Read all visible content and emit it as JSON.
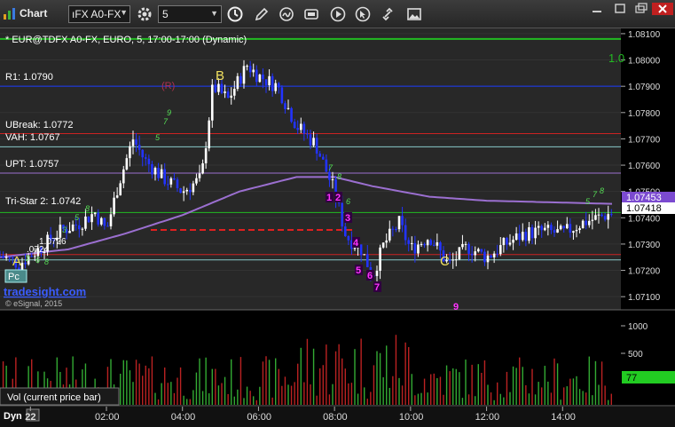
{
  "window": {
    "title": "Chart"
  },
  "toolbar": {
    "symbol": "ıFX A0-FX",
    "interval": "5",
    "icons": [
      "gear-icon",
      "refresh-clock-icon",
      "pencil-icon",
      "redraw-icon",
      "settings-panel-icon",
      "play-icon",
      "cursor-icon",
      "link-icon",
      "picture-icon"
    ]
  },
  "header": {
    "title": "* EUR@TDFX A0-FX, EURO, 5, 17:00-17:00 (Dynamic)"
  },
  "colors": {
    "green_line": "#22bb22",
    "blue_line": "#1a3cff",
    "red_line": "#cc2222",
    "cyan_line": "#88c8c8",
    "purple_line": "#9b6fd0",
    "candle_up": "#ffffff",
    "candle_down": "#2233ff",
    "price_tag": "#7b4ad0",
    "vol_tag": "#22cc22"
  },
  "levels": [
    {
      "label": "",
      "price": 1.0808,
      "color": "green",
      "right_text": "1.0"
    },
    {
      "label": "R1: 1.0790",
      "price": 1.079,
      "color": "blue"
    },
    {
      "label": "UBreak: 1.0772",
      "price": 1.0772,
      "color": "red"
    },
    {
      "label": "VAH: 1.0767",
      "price": 1.0767,
      "color": "cyan"
    },
    {
      "label": "UPT: 1.0757",
      "price": 1.0757,
      "color": "purple"
    },
    {
      "label": "Tri-Star 2: 1.0742",
      "price": 1.0742,
      "color": "green"
    },
    {
      "label": "1.0726",
      "price": 1.0726,
      "color": "red"
    },
    {
      "label": ".0724",
      "price": 1.0724,
      "color": "cyan"
    }
  ],
  "annotations": {
    "wave_labels": [
      "A",
      "B",
      "C"
    ],
    "r_marker": "(R)",
    "seq_numbers": [
      "1",
      "2",
      "3",
      "4",
      "5",
      "6",
      "7",
      "9"
    ],
    "watermark": "tradesight.com",
    "pc_badge": "Pc",
    "copyright": "© eSignal, 2015",
    "dyn": "Dyn"
  },
  "volume_panel": {
    "label": "Vol (current price bar)",
    "current": "77"
  },
  "chart_data": {
    "type": "candlestick",
    "title": "* EUR@TDFX A0-FX, EURO, 5, 17:00-17:00 (Dynamic)",
    "y_ticks": [
      "1.08100",
      "1.08000",
      "1.07900",
      "1.07800",
      "1.07700",
      "1.07600",
      "1.07500",
      "1.07400",
      "1.07300",
      "1.07200",
      "1.07100"
    ],
    "ylim": [
      1.0705,
      1.0812
    ],
    "last_price": "1.07418",
    "tag_prices": [
      "1.07453",
      "1.07418"
    ],
    "x_ticks": [
      "22",
      "02:00",
      "04:00",
      "06:00",
      "08:00",
      "10:00",
      "12:00",
      "14:00"
    ],
    "vol_ticks": [
      "1000",
      "500"
    ],
    "x_start_hour": -0.8,
    "x_end_hour": 15.3,
    "approx_path": [
      {
        "t": -0.8,
        "p": 1.07255
      },
      {
        "t": -0.3,
        "p": 1.07225
      },
      {
        "t": 0.3,
        "p": 1.0729
      },
      {
        "t": 0.8,
        "p": 1.0735
      },
      {
        "t": 1.3,
        "p": 1.0738
      },
      {
        "t": 1.7,
        "p": 1.0742
      },
      {
        "t": 2.0,
        "p": 1.0735
      },
      {
        "t": 2.3,
        "p": 1.0752
      },
      {
        "t": 2.7,
        "p": 1.077
      },
      {
        "t": 3.0,
        "p": 1.0762
      },
      {
        "t": 3.5,
        "p": 1.0755
      },
      {
        "t": 4.0,
        "p": 1.075
      },
      {
        "t": 4.5,
        "p": 1.0755
      },
      {
        "t": 4.8,
        "p": 1.079
      },
      {
        "t": 5.2,
        "p": 1.0785
      },
      {
        "t": 5.7,
        "p": 1.0798
      },
      {
        "t": 6.0,
        "p": 1.0794
      },
      {
        "t": 6.5,
        "p": 1.079
      },
      {
        "t": 7.0,
        "p": 1.0775
      },
      {
        "t": 7.5,
        "p": 1.0768
      },
      {
        "t": 8.0,
        "p": 1.075
      },
      {
        "t": 8.3,
        "p": 1.0733
      },
      {
        "t": 8.7,
        "p": 1.0728
      },
      {
        "t": 9.0,
        "p": 1.0718
      },
      {
        "t": 9.3,
        "p": 1.073
      },
      {
        "t": 9.7,
        "p": 1.0738
      },
      {
        "t": 10.0,
        "p": 1.0728
      },
      {
        "t": 10.5,
        "p": 1.0733
      },
      {
        "t": 11.0,
        "p": 1.0722
      },
      {
        "t": 11.5,
        "p": 1.0729
      },
      {
        "t": 12.0,
        "p": 1.0725
      },
      {
        "t": 12.5,
        "p": 1.073
      },
      {
        "t": 13.0,
        "p": 1.0734
      },
      {
        "t": 13.5,
        "p": 1.0735
      },
      {
        "t": 14.0,
        "p": 1.0734
      },
      {
        "t": 14.5,
        "p": 1.0738
      },
      {
        "t": 15.3,
        "p": 1.07418
      }
    ],
    "ma_path": [
      {
        "t": -0.8,
        "p": 1.0725
      },
      {
        "t": 1.0,
        "p": 1.0728
      },
      {
        "t": 2.5,
        "p": 1.0734
      },
      {
        "t": 4.0,
        "p": 1.0741
      },
      {
        "t": 5.5,
        "p": 1.075
      },
      {
        "t": 7.0,
        "p": 1.07555
      },
      {
        "t": 8.0,
        "p": 1.07555
      },
      {
        "t": 9.0,
        "p": 1.0752
      },
      {
        "t": 10.5,
        "p": 1.0748
      },
      {
        "t": 12.0,
        "p": 1.07465
      },
      {
        "t": 15.3,
        "p": 1.07453
      }
    ]
  }
}
